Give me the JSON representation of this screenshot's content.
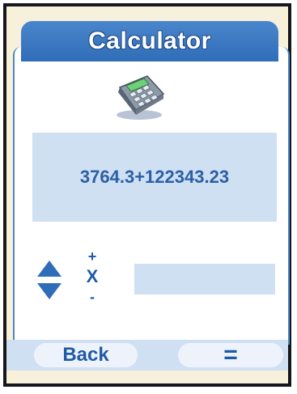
{
  "app": {
    "title": "Calculator"
  },
  "display": {
    "expression": "3764.3+122343.23"
  },
  "input": {
    "value": ""
  },
  "operators": {
    "plus": "+",
    "times": "X",
    "minus": "-"
  },
  "softkeys": {
    "back_label": "Back",
    "equals_label": "="
  },
  "icons": {
    "app": "calculator-icon",
    "scroll": "up-down-arrows-icon"
  },
  "colors": {
    "accent": "#2f6db8",
    "display_bg": "#cfe0f3",
    "text": "#1f5aa6",
    "frame": "#15171c"
  }
}
